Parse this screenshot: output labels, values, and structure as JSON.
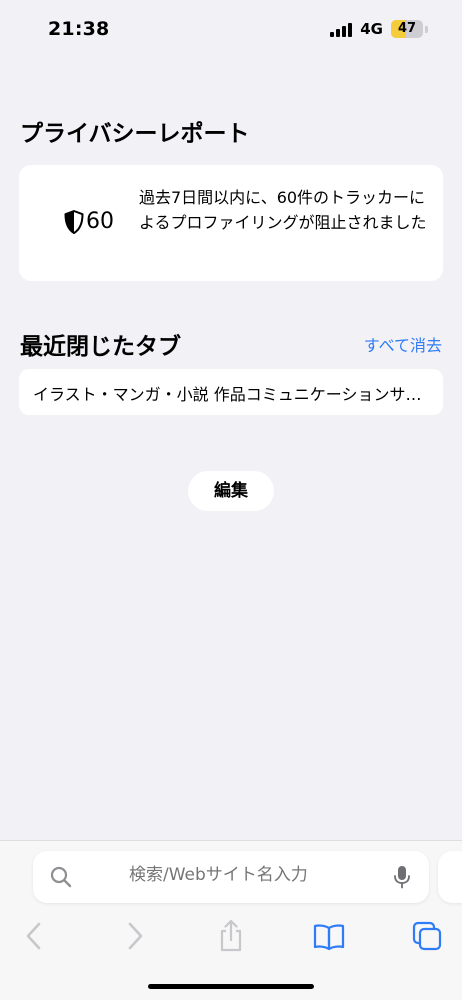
{
  "status_bar": {
    "time": "21:38",
    "network": "4G",
    "battery": "47",
    "battery_level": 0.47,
    "battery_color": "#f5cd3a"
  },
  "privacy_report": {
    "title": "プライバシーレポート",
    "tracker_count": "60",
    "description": "過去7日間以内に、60件のトラッカーによるプロファイリングが阻止されました",
    "icon": "shield-icon"
  },
  "recent_tabs": {
    "title": "最近閉じたタブ",
    "clear_all_label": "すべて消去",
    "items": [
      {
        "title": "イラスト・マンガ・小説 作品コミュニケーションサービス"
      }
    ]
  },
  "edit_label": "編集",
  "search": {
    "placeholder": "検索/Webサイト名入力"
  },
  "toolbar": {
    "back_icon": "chevron-left-icon",
    "forward_icon": "chevron-right-icon",
    "share_icon": "share-icon",
    "bookmarks_icon": "book-icon",
    "tabs_icon": "tabs-icon"
  },
  "colors": {
    "accent": "#2f7cf6",
    "background": "#f2f1f6",
    "disabled": "#c7c7cc"
  }
}
